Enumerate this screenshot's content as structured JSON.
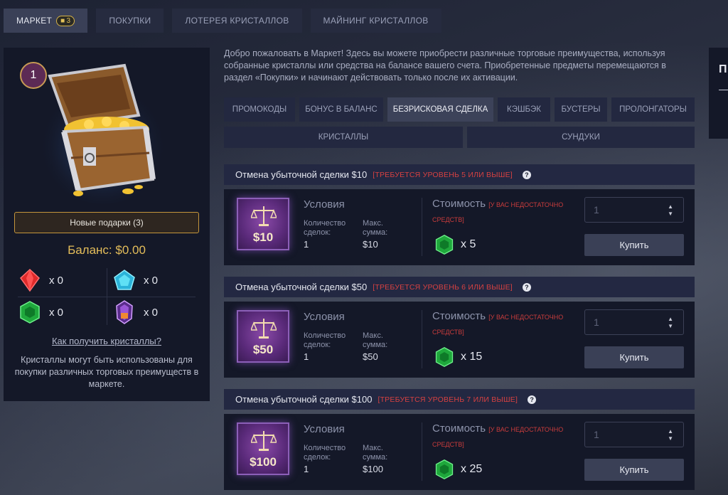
{
  "top_tabs": [
    {
      "label": "МАРКЕТ",
      "badge": "3",
      "active": true
    },
    {
      "label": "ПОКУПКИ"
    },
    {
      "label": "ЛОТЕРЕЯ КРИСТАЛЛОВ"
    },
    {
      "label": "МАЙНИНГ КРИСТАЛЛОВ"
    }
  ],
  "left": {
    "level": "1",
    "gifts_button": "Новые подарки (3)",
    "balance": "Баланс: $0.00",
    "gems": [
      {
        "color": "red",
        "count": "x 0"
      },
      {
        "color": "blue",
        "count": "x 0"
      },
      {
        "color": "green",
        "count": "x 0"
      },
      {
        "color": "purple",
        "count": "x 0"
      }
    ],
    "how_link": "Как получить кристаллы?",
    "description": "Кристаллы могут быть использованы для покупки различных торговых преимуществ в маркете."
  },
  "intro": "Добро пожаловать в Маркет! Здесь вы можете приобрести различные торговые преимущества, используя собранные кристаллы или средства на балансе вашего счета. Приобретенные предметы перемещаются в раздел «Покупки» и начинают действовать только после их активации.",
  "right_slice": {
    "letter": "П"
  },
  "sub_tabs": [
    "ПРОМОКОДЫ",
    "БОНУС В БАЛАНС",
    "БЕЗРИСКОВАЯ СДЕЛКА",
    "КЭШБЭК",
    "БУСТЕРЫ",
    "ПРОЛОНГАТОРЫ",
    "КРИСТАЛЛЫ",
    "СУНДУКИ"
  ],
  "deals": [
    {
      "title": "Отмена убыточной сделки $10",
      "requirement": "[ТРЕБУЕТСЯ УРОВЕНЬ 5 ИЛИ ВЫШЕ]",
      "amount": "$10",
      "conditions_title": "Условия",
      "deals_label": "Количество сделок:",
      "deals_value": "1",
      "max_label": "Макс. сумма:",
      "max_value": "$10",
      "cost_title": "Стоимость",
      "cost_warn_1": "[У ВАС НЕДОСТАТОЧНО",
      "cost_warn_2": "СРЕДСТВ]",
      "cost_value": "x 5",
      "qty": "1",
      "buy": "Купить"
    },
    {
      "title": "Отмена убыточной сделки $50",
      "requirement": "[ТРЕБУЕТСЯ УРОВЕНЬ 6 ИЛИ ВЫШЕ]",
      "amount": "$50",
      "conditions_title": "Условия",
      "deals_label": "Количество сделок:",
      "deals_value": "1",
      "max_label": "Макс. сумма:",
      "max_value": "$50",
      "cost_title": "Стоимость",
      "cost_warn_1": "[У ВАС НЕДОСТАТОЧНО",
      "cost_warn_2": "СРЕДСТВ]",
      "cost_value": "x 15",
      "qty": "1",
      "buy": "Купить"
    },
    {
      "title": "Отмена убыточной сделки $100",
      "requirement": "[ТРЕБУЕТСЯ УРОВЕНЬ 7 ИЛИ ВЫШЕ]",
      "amount": "$100",
      "conditions_title": "Условия",
      "deals_label": "Количество сделок:",
      "deals_value": "1",
      "max_label": "Макс. сумма:",
      "max_value": "$100",
      "cost_title": "Стоимость",
      "cost_warn_1": "[У ВАС НЕДОСТАТОЧНО",
      "cost_warn_2": "СРЕДСТВ]",
      "cost_value": "x 25",
      "qty": "1",
      "buy": "Купить"
    }
  ]
}
